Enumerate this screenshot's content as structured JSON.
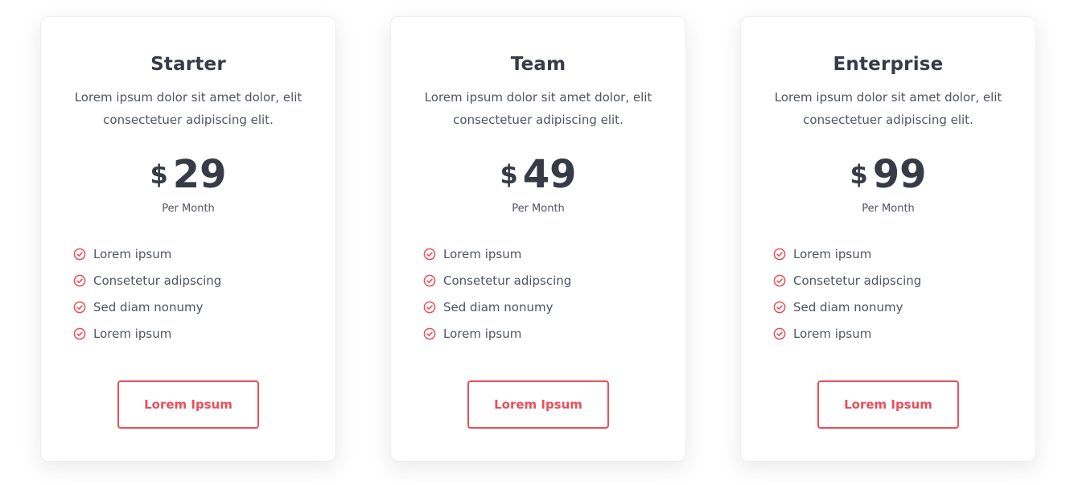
{
  "theme": {
    "accent": "#e8505b",
    "heading": "#363b46",
    "text": "#4f5560"
  },
  "plans": [
    {
      "title": "Starter",
      "description": "Lorem ipsum dolor sit amet dolor, elit consectetuer adipiscing elit.",
      "currency": "$",
      "price": "29",
      "period": "Per Month",
      "features": [
        "Lorem ipsum",
        "Consetetur adipscing",
        "Sed diam nonumy",
        "Lorem ipsum"
      ],
      "feature_icon": "check-circle-icon",
      "button_label": "Lorem Ipsum"
    },
    {
      "title": "Team",
      "description": "Lorem ipsum dolor sit amet dolor, elit consectetuer adipiscing elit.",
      "currency": "$",
      "price": "49",
      "period": "Per Month",
      "features": [
        "Lorem ipsum",
        "Consetetur adipscing",
        "Sed diam nonumy",
        "Lorem ipsum"
      ],
      "feature_icon": "check-circle-icon",
      "button_label": "Lorem Ipsum"
    },
    {
      "title": "Enterprise",
      "description": "Lorem ipsum dolor sit amet dolor, elit consectetuer adipiscing elit.",
      "currency": "$",
      "price": "99",
      "period": "Per Month",
      "features": [
        "Lorem ipsum",
        "Consetetur adipscing",
        "Sed diam nonumy",
        "Lorem ipsum"
      ],
      "feature_icon": "check-circle-icon",
      "button_label": "Lorem Ipsum"
    }
  ]
}
